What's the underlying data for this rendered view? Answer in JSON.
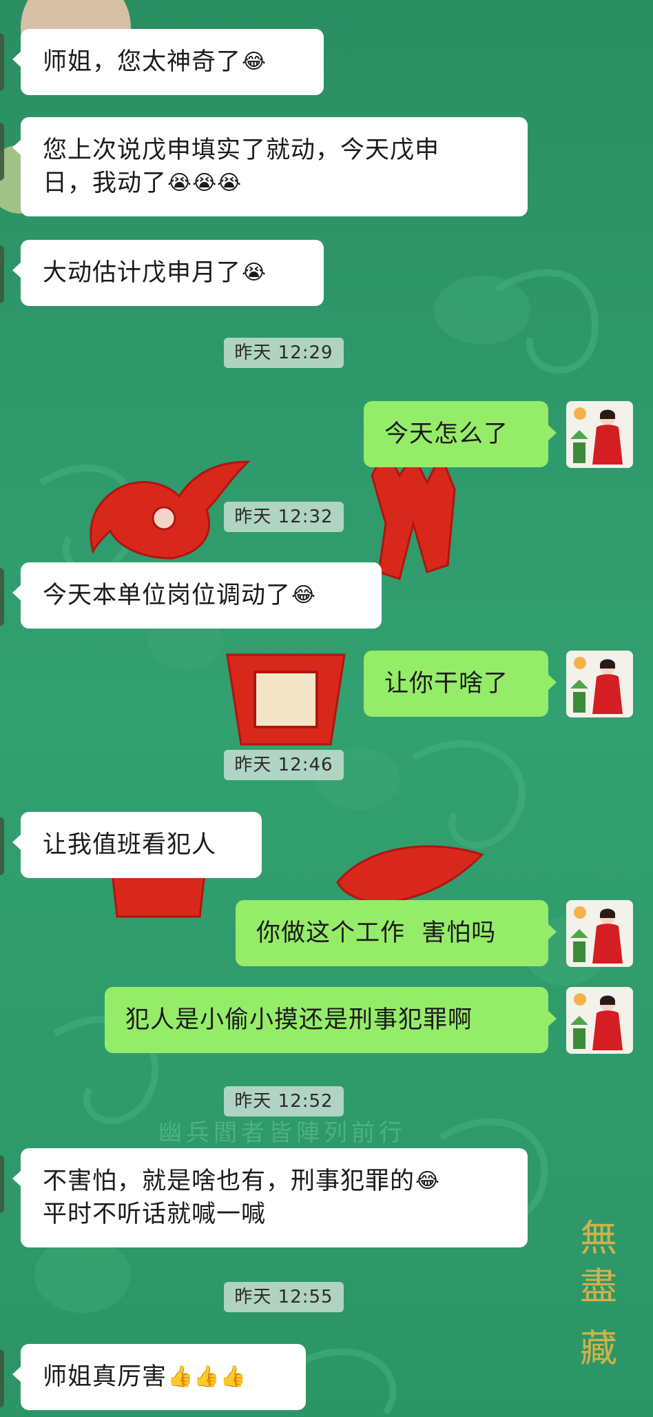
{
  "messages": [
    {
      "text": "师姐，您太神奇了",
      "emoji": "😂"
    },
    {
      "line1": "您上次说戊申填实了就动，今天戊申",
      "line2": "日，我动了",
      "emoji": "😭😭😭"
    },
    {
      "text": "大动估计戊申月了",
      "emoji": "😭"
    },
    {
      "time": "昨天  12:29"
    },
    {
      "text": "今天怎么了"
    },
    {
      "time": "昨天  12:32"
    },
    {
      "text": "今天本单位岗位调动了",
      "emoji": "😂"
    },
    {
      "text": "让你干啥了"
    },
    {
      "time": "昨天  12:46"
    },
    {
      "text": "让我值班看犯人"
    },
    {
      "text": "你做这个工作  害怕吗"
    },
    {
      "text": "犯人是小偷小摸还是刑事犯罪啊"
    },
    {
      "time": "昨天  12:52"
    },
    {
      "line1": "不害怕，就是啥也有，刑事犯罪的",
      "line2": "平时不听话就喊一喊",
      "emoji": "😂"
    },
    {
      "time": "昨天  12:55"
    },
    {
      "text": "师姐真厉害",
      "emoji": "👍👍👍"
    }
  ],
  "background_text": {
    "vertical_caption": "無盡藏",
    "horizontal_caption": "幽兵閻者皆陣列前行"
  },
  "colors": {
    "background": "#2f9a6c",
    "incoming_bubble": "#ffffff",
    "outgoing_bubble": "#95ec69",
    "timestamp_chip": "#cde1d4",
    "red_ornament": "#d8281c"
  }
}
